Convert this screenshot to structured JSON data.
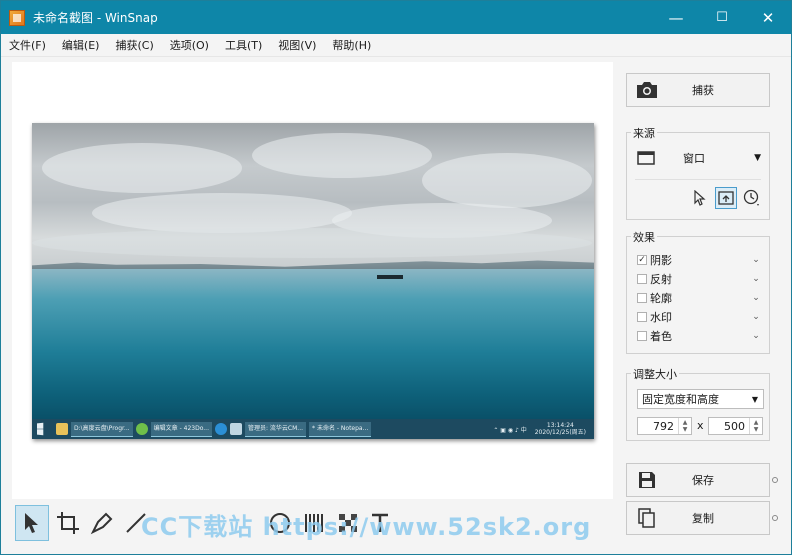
{
  "window": {
    "title": "未命名截图 - WinSnap",
    "controls": [
      "—",
      "☐",
      "✕"
    ]
  },
  "menu": [
    "文件(F)",
    "编辑(E)",
    "捕获(C)",
    "选项(O)",
    "工具(T)",
    "视图(V)",
    "帮助(H)"
  ],
  "taskbar": {
    "items": [
      "D:\\高度云盘\\Progr...",
      "编辑文章 - 423Do...",
      "管理员: 流华云CM...",
      "* 未命名 - Notepa..."
    ],
    "time": "13:14:24",
    "date": "2020/12/25(周五)"
  },
  "watermark": "CC下载站 https://www.52sk2.org",
  "right_panel": {
    "capture_label": "捕获",
    "source": {
      "title": "来源",
      "mode": "窗口"
    },
    "effects": {
      "title": "效果",
      "items": [
        {
          "label": "阴影",
          "checked": "✓"
        },
        {
          "label": "反射",
          "checked": ""
        },
        {
          "label": "轮廓",
          "checked": ""
        },
        {
          "label": "水印",
          "checked": ""
        },
        {
          "label": "着色",
          "checked": ""
        }
      ]
    },
    "resize": {
      "title": "调整大小",
      "mode": "固定宽度和高度",
      "width": "792",
      "x": "x",
      "height": "500"
    },
    "save_label": "保存",
    "copy_label": "复制"
  },
  "colors": {
    "titlebar": "#0e86a8",
    "accent": "#4a9ccc"
  }
}
